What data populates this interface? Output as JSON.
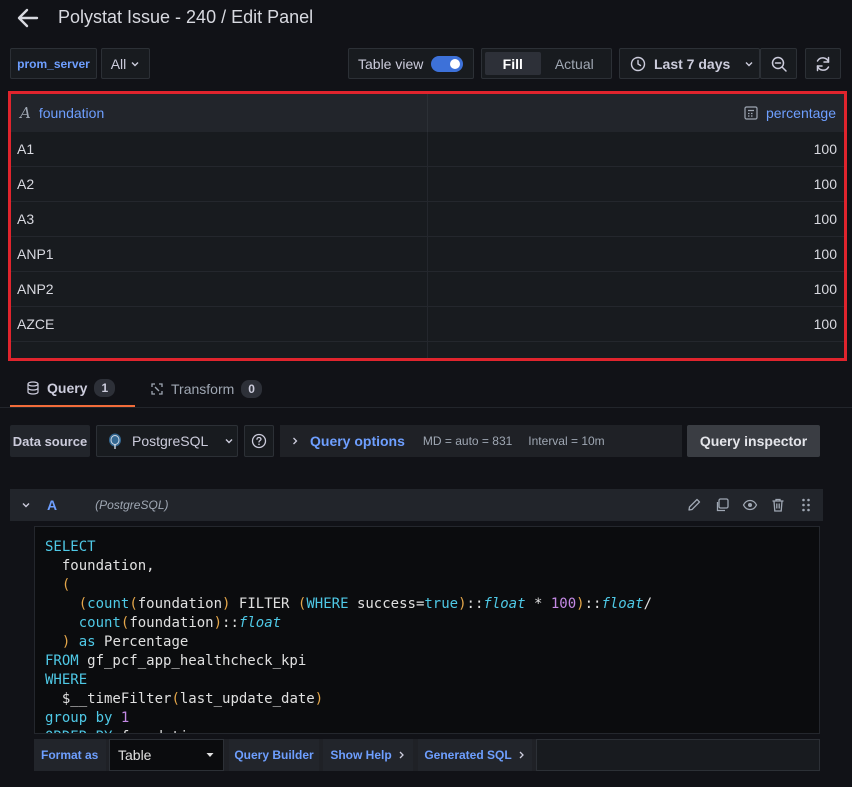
{
  "header": {
    "title": "Polystat Issue - 240 / Edit Panel"
  },
  "toolbar": {
    "variable_label": "prom_server",
    "variable_value": "All",
    "table_view_label": "Table view",
    "table_view_on": true,
    "fill_label": "Fill",
    "actual_label": "Actual",
    "time_range": "Last 7 days"
  },
  "table": {
    "columns": [
      "foundation",
      "percentage"
    ],
    "rows": [
      [
        "A1",
        "100"
      ],
      [
        "A2",
        "100"
      ],
      [
        "A3",
        "100"
      ],
      [
        "ANP1",
        "100"
      ],
      [
        "ANP2",
        "100"
      ],
      [
        "AZCE",
        "100"
      ]
    ]
  },
  "tabs": [
    {
      "label": "Query",
      "count": "1"
    },
    {
      "label": "Transform",
      "count": "0"
    }
  ],
  "datasource": {
    "label": "Data source",
    "selected": "PostgreSQL",
    "query_options_label": "Query options",
    "md": "MD = auto = 831",
    "interval": "Interval = 10m",
    "inspector_label": "Query inspector"
  },
  "query": {
    "name": "A",
    "datasource": "(PostgreSQL)"
  },
  "bottom_bar": {
    "format_as": "Format as",
    "format_value": "Table",
    "query_builder": "Query Builder",
    "show_help": "Show Help",
    "generated_sql": "Generated SQL"
  },
  "colors": {
    "accent": "#6e9fff",
    "highlight_border": "#e0242d",
    "active_tab": "#f26c3a",
    "toggle_on": "#3d71d9"
  }
}
